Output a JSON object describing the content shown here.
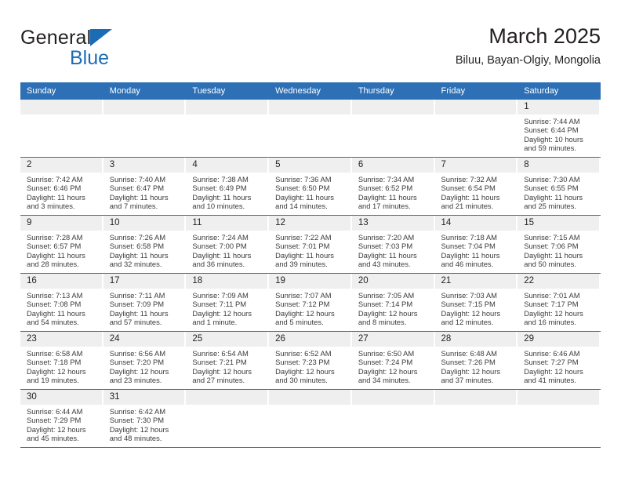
{
  "brand": {
    "name_top": "General",
    "name_bottom": "Blue",
    "logo_icon": "triangle-icon",
    "accent_color": "#1c6cb5"
  },
  "header": {
    "title": "March 2025",
    "subtitle": "Biluu, Bayan-Olgiy, Mongolia"
  },
  "theme": {
    "header_blue": "#2e70b5",
    "daynum_gray": "#efefef",
    "text": "#231f20"
  },
  "calendar": {
    "weekday_headers": [
      "Sunday",
      "Monday",
      "Tuesday",
      "Wednesday",
      "Thursday",
      "Friday",
      "Saturday"
    ],
    "labels": {
      "sunrise": "Sunrise:",
      "sunset": "Sunset:",
      "daylight": "Daylight:"
    },
    "weeks": [
      [
        {
          "day": "",
          "blank": true
        },
        {
          "day": "",
          "blank": true
        },
        {
          "day": "",
          "blank": true
        },
        {
          "day": "",
          "blank": true
        },
        {
          "day": "",
          "blank": true
        },
        {
          "day": "",
          "blank": true
        },
        {
          "day": "1",
          "sunrise": "Sunrise: 7:44 AM",
          "sunset": "Sunset: 6:44 PM",
          "daylight1": "Daylight: 10 hours",
          "daylight2": "and 59 minutes."
        }
      ],
      [
        {
          "day": "2",
          "sunrise": "Sunrise: 7:42 AM",
          "sunset": "Sunset: 6:46 PM",
          "daylight1": "Daylight: 11 hours",
          "daylight2": "and 3 minutes."
        },
        {
          "day": "3",
          "sunrise": "Sunrise: 7:40 AM",
          "sunset": "Sunset: 6:47 PM",
          "daylight1": "Daylight: 11 hours",
          "daylight2": "and 7 minutes."
        },
        {
          "day": "4",
          "sunrise": "Sunrise: 7:38 AM",
          "sunset": "Sunset: 6:49 PM",
          "daylight1": "Daylight: 11 hours",
          "daylight2": "and 10 minutes."
        },
        {
          "day": "5",
          "sunrise": "Sunrise: 7:36 AM",
          "sunset": "Sunset: 6:50 PM",
          "daylight1": "Daylight: 11 hours",
          "daylight2": "and 14 minutes."
        },
        {
          "day": "6",
          "sunrise": "Sunrise: 7:34 AM",
          "sunset": "Sunset: 6:52 PM",
          "daylight1": "Daylight: 11 hours",
          "daylight2": "and 17 minutes."
        },
        {
          "day": "7",
          "sunrise": "Sunrise: 7:32 AM",
          "sunset": "Sunset: 6:54 PM",
          "daylight1": "Daylight: 11 hours",
          "daylight2": "and 21 minutes."
        },
        {
          "day": "8",
          "sunrise": "Sunrise: 7:30 AM",
          "sunset": "Sunset: 6:55 PM",
          "daylight1": "Daylight: 11 hours",
          "daylight2": "and 25 minutes."
        }
      ],
      [
        {
          "day": "9",
          "sunrise": "Sunrise: 7:28 AM",
          "sunset": "Sunset: 6:57 PM",
          "daylight1": "Daylight: 11 hours",
          "daylight2": "and 28 minutes."
        },
        {
          "day": "10",
          "sunrise": "Sunrise: 7:26 AM",
          "sunset": "Sunset: 6:58 PM",
          "daylight1": "Daylight: 11 hours",
          "daylight2": "and 32 minutes."
        },
        {
          "day": "11",
          "sunrise": "Sunrise: 7:24 AM",
          "sunset": "Sunset: 7:00 PM",
          "daylight1": "Daylight: 11 hours",
          "daylight2": "and 36 minutes."
        },
        {
          "day": "12",
          "sunrise": "Sunrise: 7:22 AM",
          "sunset": "Sunset: 7:01 PM",
          "daylight1": "Daylight: 11 hours",
          "daylight2": "and 39 minutes."
        },
        {
          "day": "13",
          "sunrise": "Sunrise: 7:20 AM",
          "sunset": "Sunset: 7:03 PM",
          "daylight1": "Daylight: 11 hours",
          "daylight2": "and 43 minutes."
        },
        {
          "day": "14",
          "sunrise": "Sunrise: 7:18 AM",
          "sunset": "Sunset: 7:04 PM",
          "daylight1": "Daylight: 11 hours",
          "daylight2": "and 46 minutes."
        },
        {
          "day": "15",
          "sunrise": "Sunrise: 7:15 AM",
          "sunset": "Sunset: 7:06 PM",
          "daylight1": "Daylight: 11 hours",
          "daylight2": "and 50 minutes."
        }
      ],
      [
        {
          "day": "16",
          "sunrise": "Sunrise: 7:13 AM",
          "sunset": "Sunset: 7:08 PM",
          "daylight1": "Daylight: 11 hours",
          "daylight2": "and 54 minutes."
        },
        {
          "day": "17",
          "sunrise": "Sunrise: 7:11 AM",
          "sunset": "Sunset: 7:09 PM",
          "daylight1": "Daylight: 11 hours",
          "daylight2": "and 57 minutes."
        },
        {
          "day": "18",
          "sunrise": "Sunrise: 7:09 AM",
          "sunset": "Sunset: 7:11 PM",
          "daylight1": "Daylight: 12 hours",
          "daylight2": "and 1 minute."
        },
        {
          "day": "19",
          "sunrise": "Sunrise: 7:07 AM",
          "sunset": "Sunset: 7:12 PM",
          "daylight1": "Daylight: 12 hours",
          "daylight2": "and 5 minutes."
        },
        {
          "day": "20",
          "sunrise": "Sunrise: 7:05 AM",
          "sunset": "Sunset: 7:14 PM",
          "daylight1": "Daylight: 12 hours",
          "daylight2": "and 8 minutes."
        },
        {
          "day": "21",
          "sunrise": "Sunrise: 7:03 AM",
          "sunset": "Sunset: 7:15 PM",
          "daylight1": "Daylight: 12 hours",
          "daylight2": "and 12 minutes."
        },
        {
          "day": "22",
          "sunrise": "Sunrise: 7:01 AM",
          "sunset": "Sunset: 7:17 PM",
          "daylight1": "Daylight: 12 hours",
          "daylight2": "and 16 minutes."
        }
      ],
      [
        {
          "day": "23",
          "sunrise": "Sunrise: 6:58 AM",
          "sunset": "Sunset: 7:18 PM",
          "daylight1": "Daylight: 12 hours",
          "daylight2": "and 19 minutes."
        },
        {
          "day": "24",
          "sunrise": "Sunrise: 6:56 AM",
          "sunset": "Sunset: 7:20 PM",
          "daylight1": "Daylight: 12 hours",
          "daylight2": "and 23 minutes."
        },
        {
          "day": "25",
          "sunrise": "Sunrise: 6:54 AM",
          "sunset": "Sunset: 7:21 PM",
          "daylight1": "Daylight: 12 hours",
          "daylight2": "and 27 minutes."
        },
        {
          "day": "26",
          "sunrise": "Sunrise: 6:52 AM",
          "sunset": "Sunset: 7:23 PM",
          "daylight1": "Daylight: 12 hours",
          "daylight2": "and 30 minutes."
        },
        {
          "day": "27",
          "sunrise": "Sunrise: 6:50 AM",
          "sunset": "Sunset: 7:24 PM",
          "daylight1": "Daylight: 12 hours",
          "daylight2": "and 34 minutes."
        },
        {
          "day": "28",
          "sunrise": "Sunrise: 6:48 AM",
          "sunset": "Sunset: 7:26 PM",
          "daylight1": "Daylight: 12 hours",
          "daylight2": "and 37 minutes."
        },
        {
          "day": "29",
          "sunrise": "Sunrise: 6:46 AM",
          "sunset": "Sunset: 7:27 PM",
          "daylight1": "Daylight: 12 hours",
          "daylight2": "and 41 minutes."
        }
      ],
      [
        {
          "day": "30",
          "sunrise": "Sunrise: 6:44 AM",
          "sunset": "Sunset: 7:29 PM",
          "daylight1": "Daylight: 12 hours",
          "daylight2": "and 45 minutes."
        },
        {
          "day": "31",
          "sunrise": "Sunrise: 6:42 AM",
          "sunset": "Sunset: 7:30 PM",
          "daylight1": "Daylight: 12 hours",
          "daylight2": "and 48 minutes."
        },
        {
          "day": "",
          "blank": true
        },
        {
          "day": "",
          "blank": true
        },
        {
          "day": "",
          "blank": true
        },
        {
          "day": "",
          "blank": true
        },
        {
          "day": "",
          "blank": true
        }
      ]
    ]
  }
}
